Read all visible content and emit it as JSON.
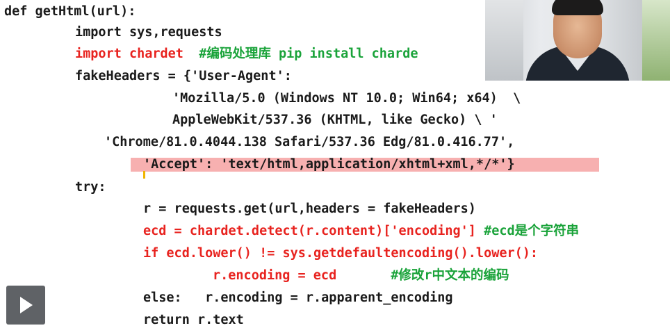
{
  "code_lines": [
    {
      "indent": "",
      "text": "def getHtml(url):",
      "comment": ""
    },
    {
      "indent": "     ",
      "text": "import sys,requests",
      "comment": ""
    },
    {
      "indent": "     ",
      "text": "import chardet  ",
      "comment": "#编码处理库 pip install charde"
    },
    {
      "indent": "     ",
      "text": "fakeHeaders = {'User-Agent':",
      "comment": ""
    },
    {
      "indent": "            ",
      "text": "'Mozilla/5.0 (Windows NT 10.0; Win64; x64)  \\",
      "comment": ""
    },
    {
      "indent": "            ",
      "text": "AppleWebKit/537.36 (KHTML, like Gecko) \\ '",
      "comment": ""
    },
    {
      "indent": "       ",
      "text": "'Chrome/81.0.4044.138 Safari/537.36 Edg/81.0.416.77',",
      "comment": ""
    },
    {
      "indent": "          ",
      "text": "'Accept': 'text/html,application/xhtml+xml,*/*'}",
      "comment": ""
    },
    {
      "indent": "     ",
      "text": "try:",
      "comment": ""
    },
    {
      "indent": "          ",
      "text": "r = requests.get(url,headers = fakeHeaders)",
      "comment": ""
    },
    {
      "indent": "          ",
      "text": "ecd = chardet.detect(r.content)['encoding'] ",
      "comment": "#ecd是个字符串"
    },
    {
      "indent": "          ",
      "text": "if ecd.lower() != sys.getdefaultencoding().lower():",
      "comment": ""
    },
    {
      "indent": "               ",
      "text": "r.encoding = ecd       ",
      "comment": "#修改r中文本的编码"
    },
    {
      "indent": "          ",
      "text": "else:   r.encoding = r.apparent_encoding",
      "comment": ""
    },
    {
      "indent": "          ",
      "text": "return r.text",
      "comment": ""
    }
  ],
  "colors": {
    "red": "#e8231f",
    "green": "#1aa33a",
    "highlight": "#f6a2a2"
  },
  "controls": {
    "play_icon": "play-icon"
  }
}
